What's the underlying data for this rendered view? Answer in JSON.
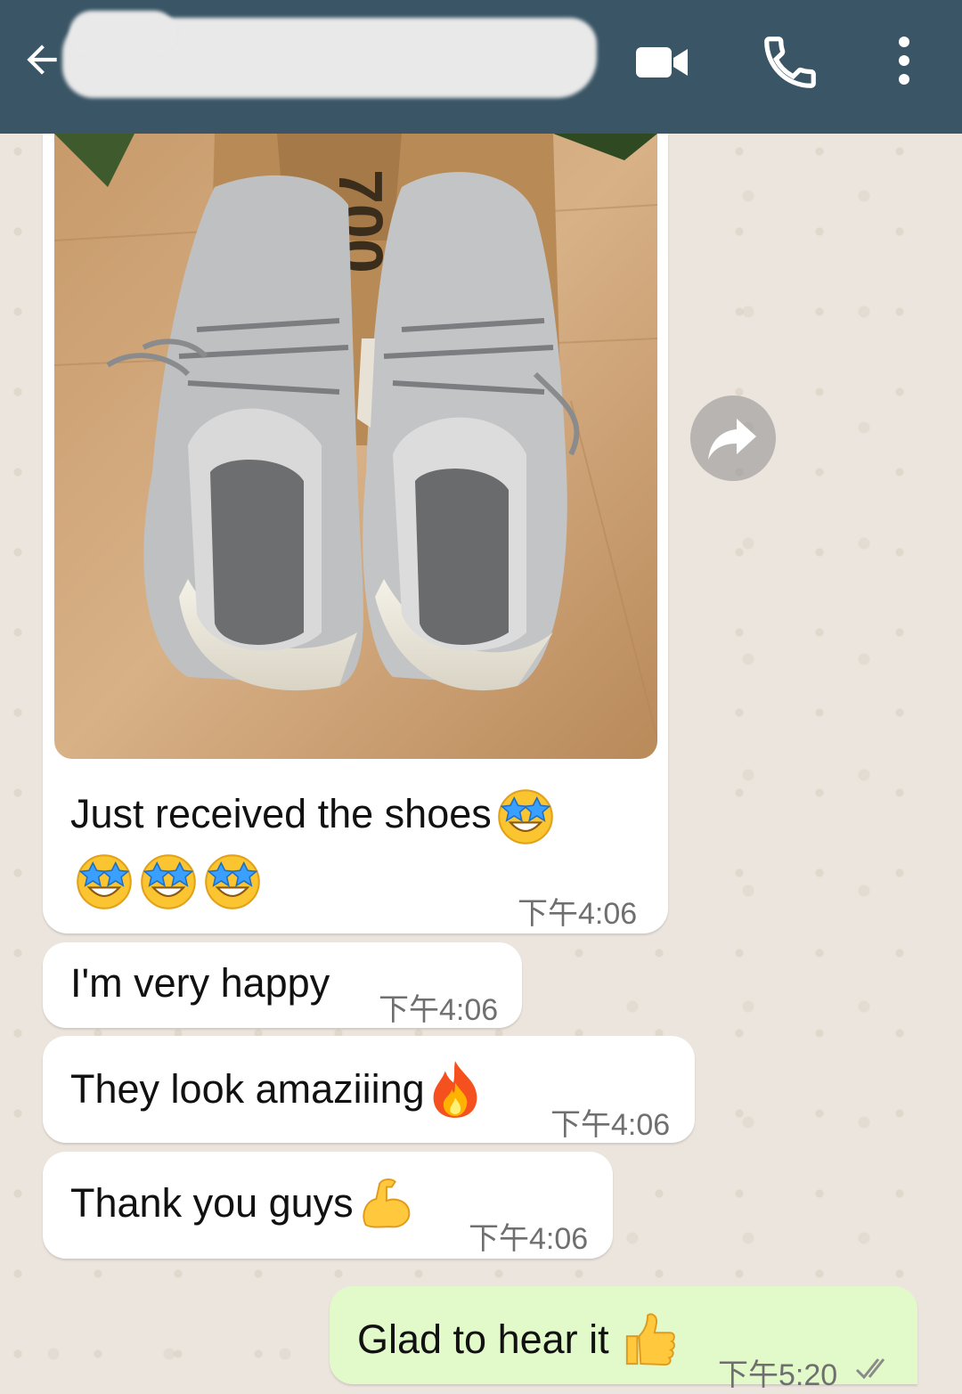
{
  "header": {
    "contact_name": "",
    "background": "#3a5566",
    "icons": [
      "back-arrow-icon",
      "video-call-icon",
      "phone-icon",
      "more-vert-icon"
    ]
  },
  "messages": {
    "image_message": {
      "caption_line1": "Just received the shoes",
      "time": "下午4:06"
    },
    "msg2": {
      "text": "I'm very happy",
      "time": "下午4:06"
    },
    "msg3": {
      "text": "They look amaziiing",
      "time": "下午4:06"
    },
    "msg4": {
      "text": "Thank you guys",
      "time": "下午4:06"
    },
    "msg5": {
      "text": "Glad to hear it",
      "time": "下午5:20"
    }
  },
  "colors": {
    "incoming_bubble": "#ffffff",
    "outgoing_bubble": "#e2f9c9",
    "wallpaper": "#ece5dd",
    "time_text": "#6f6f6f"
  }
}
